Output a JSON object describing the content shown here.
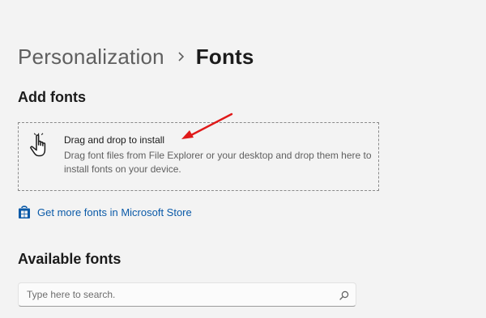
{
  "breadcrumb": {
    "parent": "Personalization",
    "current": "Fonts"
  },
  "add_fonts": {
    "title": "Add fonts",
    "dropzone_title": "Drag and drop to install",
    "dropzone_description": "Drag font files from File Explorer or your desktop and drop them here to install fonts on your device."
  },
  "store_link": {
    "label": "Get more fonts in Microsoft Store",
    "icon": "store-bag-icon"
  },
  "available_fonts": {
    "title": "Available fonts",
    "search_placeholder": "Type here to search.",
    "search_value": ""
  },
  "colors": {
    "background": "#f3f3f3",
    "link": "#0a5aa8",
    "annotation_arrow": "#e01919",
    "dropzone_border": "#8a8a8a"
  }
}
